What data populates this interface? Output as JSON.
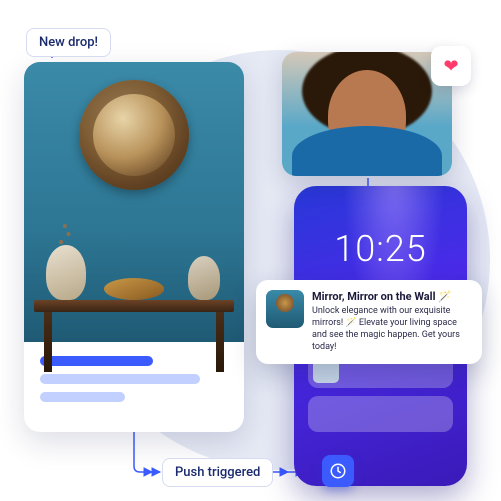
{
  "tags": {
    "new_drop": "New drop!",
    "push_triggered": "Push triggered"
  },
  "phone": {
    "time": "10:25"
  },
  "notification": {
    "title": "Mirror, Mirror on the Wall 🪄",
    "body": "Unlock elegance with our exquisite mirrors! 🪄 Elevate your living space and see the magic happen. Get yours today!"
  },
  "icons": {
    "heart": "❤",
    "clock": "clock-icon"
  }
}
